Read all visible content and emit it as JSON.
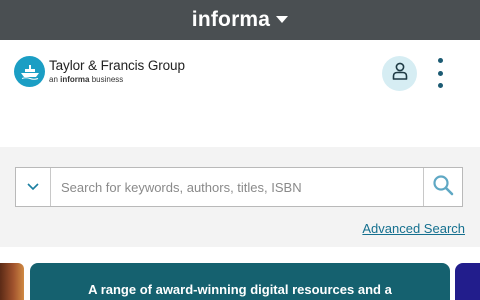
{
  "topbar": {
    "brand": "informa",
    "icon": "caret-down-icon"
  },
  "header": {
    "logo": {
      "name": "Taylor & Francis Group",
      "sub_prefix": "an",
      "sub_brand": "informa",
      "sub_suffix": "business"
    },
    "account_icon": "user-icon",
    "menu_icon": "kebab-menu-icon"
  },
  "search": {
    "placeholder": "Search for keywords, authors, titles, ISBN",
    "scope_icon": "chevron-down-icon",
    "submit_icon": "search-icon",
    "advanced_label": "Advanced Search"
  },
  "carousel": {
    "card_title": "A range of award-winning digital resources and a"
  },
  "colors": {
    "topbar": "#4a4f52",
    "brand_teal": "#1b9ec4",
    "link": "#15708f",
    "card_teal": "#15616f",
    "card_navy": "#221d8c"
  }
}
